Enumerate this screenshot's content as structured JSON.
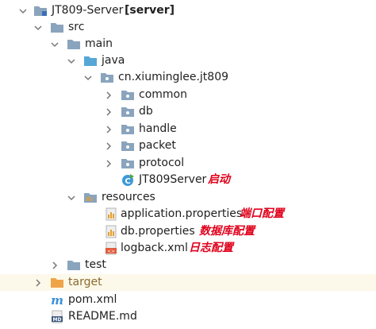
{
  "project": {
    "name": "JT809-Server",
    "module_tag": "[server]"
  },
  "tree": {
    "src": "src",
    "main": "main",
    "java": "java",
    "package": "cn.xiuminglee.jt809",
    "common": "common",
    "db": "db",
    "handle": "handle",
    "packet": "packet",
    "protocol": "protocol",
    "main_class": "JT809Server",
    "resources": "resources",
    "app_props": "application.properties",
    "db_props": "db.properties",
    "logback": "logback.xml",
    "test": "test",
    "target": "target",
    "pom": "pom.xml",
    "readme": "README.md"
  },
  "notes": {
    "startup": "启动",
    "port_config": "端口配置",
    "db_config": "数据库配置",
    "log_config": "日志配置"
  },
  "colors": {
    "folder": "#8aa4bd",
    "folder_blue": "#55a7d6",
    "folder_target": "#f0a44a",
    "annotation": "#e0001b",
    "excluded_bg": "#fdf9ea"
  }
}
